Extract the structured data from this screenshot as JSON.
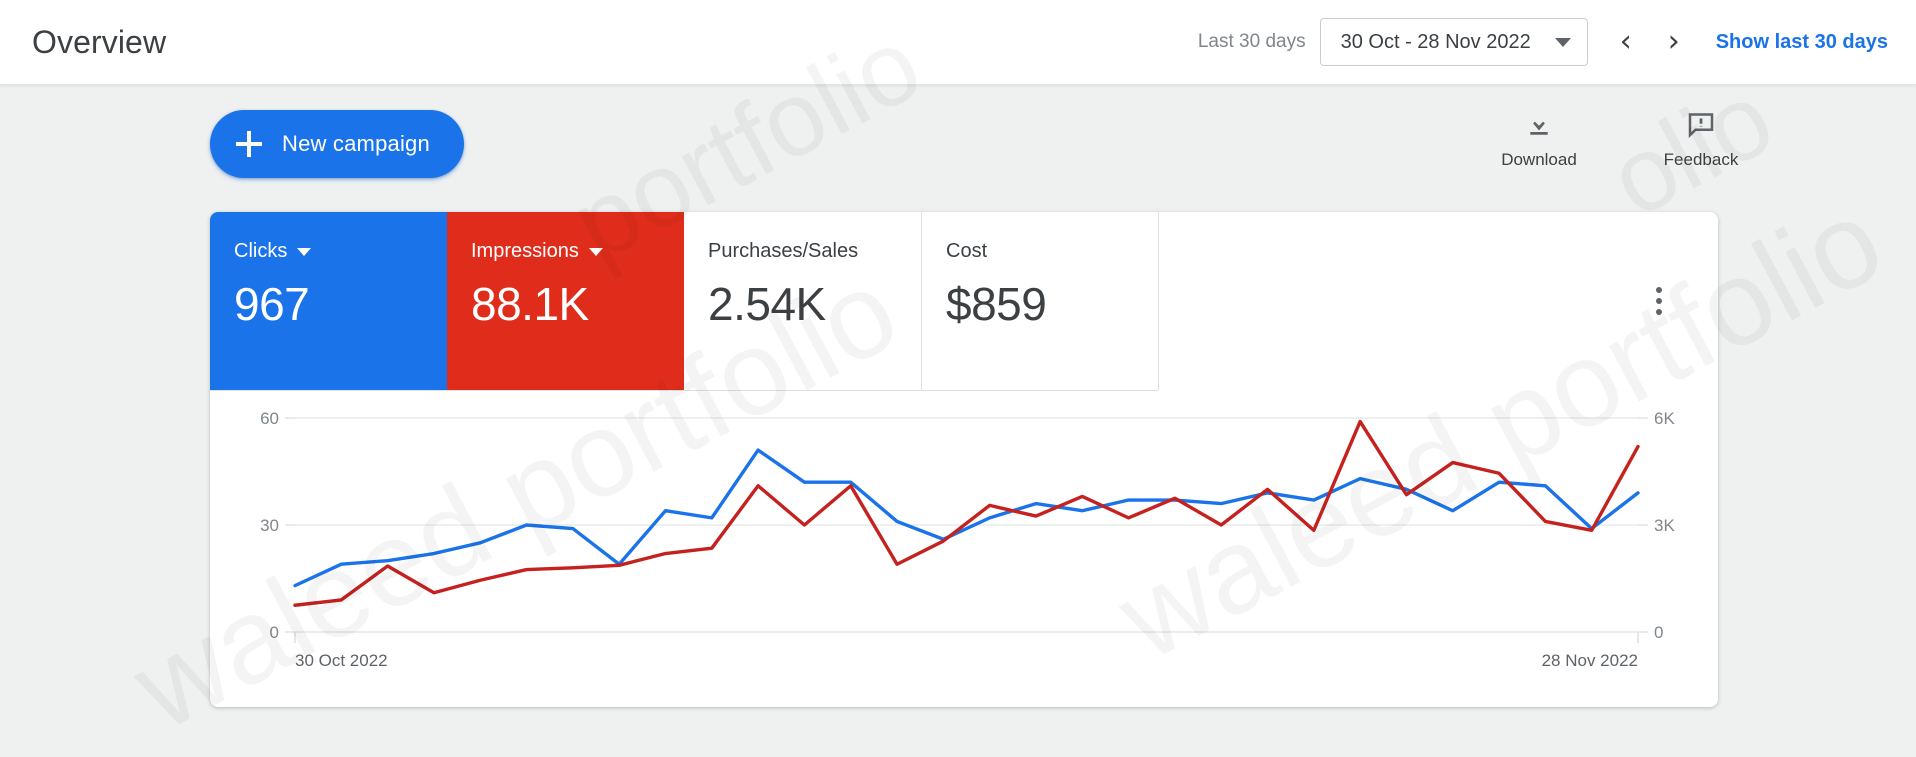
{
  "header": {
    "title": "Overview",
    "range_label": "Last 30 days",
    "range_value": "30 Oct - 28 Nov 2022",
    "prev_icon": "chevron-left-icon",
    "next_icon": "chevron-right-icon",
    "prev_glyph": "‹",
    "next_glyph": "›",
    "show_last": "Show last 30 days",
    "accent": "#1a73e8"
  },
  "actions": {
    "new_campaign": "New campaign",
    "download": "Download",
    "feedback": "Feedback"
  },
  "metrics": [
    {
      "title": "Clicks",
      "value": "967",
      "color": "#1a73e8",
      "has_caret": true,
      "selected": true
    },
    {
      "title": "Impressions",
      "value": "88.1K",
      "color": "#e02d1b",
      "has_caret": true,
      "selected": true
    },
    {
      "title": "Purchases/Sales",
      "value": "2.54K",
      "color": "#3c4043",
      "has_caret": false,
      "selected": false
    },
    {
      "title": "Cost",
      "value": "$859",
      "color": "#3c4043",
      "has_caret": false,
      "selected": false
    }
  ],
  "menu": {
    "label": "More options"
  },
  "chart_data": {
    "type": "line",
    "title": "",
    "xlabel": "",
    "ylabel": "Clicks",
    "y2label": "Impressions",
    "grid": true,
    "legend": "none",
    "x_tick_labels": [
      "30 Oct 2022",
      "28 Nov 2022"
    ],
    "left_axis": {
      "ticks": [
        0,
        30,
        60
      ],
      "tick_labels": [
        "0",
        "30",
        "60"
      ],
      "min": 0,
      "max": 60
    },
    "right_axis": {
      "ticks": [
        0,
        3000,
        6000
      ],
      "tick_labels": [
        "0",
        "3K",
        "6K"
      ],
      "min": 0,
      "max": 6000
    },
    "x": [
      "30 Oct",
      "31 Oct",
      "1 Nov",
      "2 Nov",
      "3 Nov",
      "4 Nov",
      "5 Nov",
      "6 Nov",
      "7 Nov",
      "8 Nov",
      "9 Nov",
      "10 Nov",
      "11 Nov",
      "12 Nov",
      "13 Nov",
      "14 Nov",
      "15 Nov",
      "16 Nov",
      "17 Nov",
      "18 Nov",
      "19 Nov",
      "20 Nov",
      "21 Nov",
      "22 Nov",
      "23 Nov",
      "24 Nov",
      "25 Nov",
      "26 Nov",
      "27 Nov",
      "28 Nov"
    ],
    "series": [
      {
        "name": "Clicks",
        "color": "#1a73e8",
        "axis": "left",
        "values": [
          13,
          19,
          20,
          22,
          25,
          30,
          29,
          19,
          34,
          32,
          51,
          42,
          42,
          31,
          26,
          32,
          36,
          34,
          37,
          37,
          36,
          39,
          37,
          43,
          40,
          34,
          42,
          41,
          29,
          39
        ]
      },
      {
        "name": "Impressions",
        "color": "#c5221f",
        "axis": "right",
        "values": [
          750,
          900,
          1850,
          1100,
          1450,
          1750,
          1800,
          1870,
          2200,
          2350,
          4100,
          3000,
          4100,
          1900,
          2550,
          3550,
          3250,
          3800,
          3200,
          3750,
          3000,
          4000,
          2850,
          5900,
          3850,
          4750,
          4450,
          3100,
          2850,
          5200
        ]
      }
    ]
  }
}
